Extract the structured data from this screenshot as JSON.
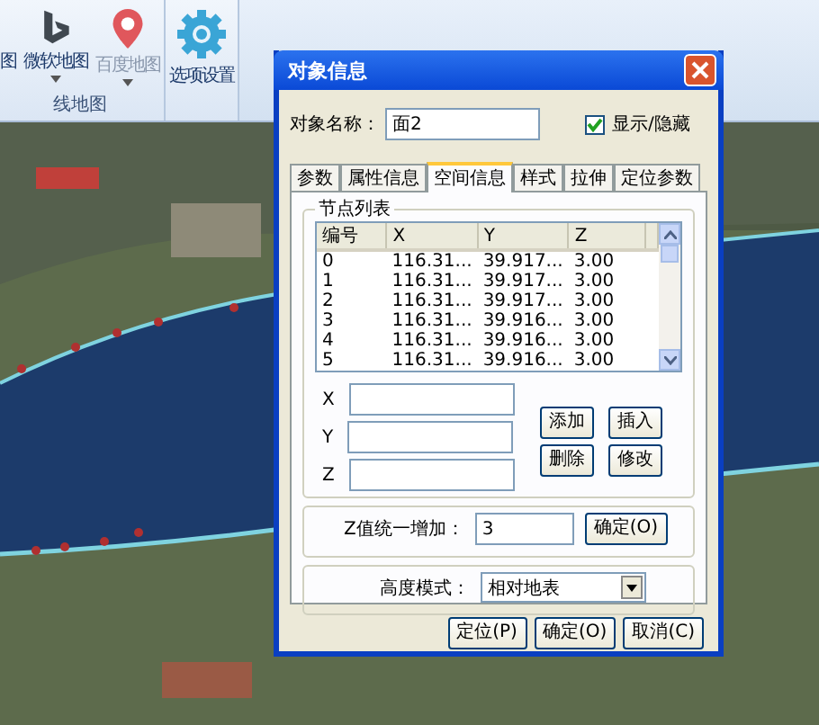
{
  "ribbon": {
    "groups": [
      {
        "label": "线地图",
        "buttons": [
          {
            "label": "图",
            "kind": "partial",
            "disabled": false,
            "dropdown": false
          },
          {
            "label": "微软地图",
            "kind": "bing",
            "disabled": false,
            "dropdown": true
          },
          {
            "label": "百度地图",
            "kind": "pin",
            "disabled": true,
            "dropdown": true
          }
        ]
      },
      {
        "buttons": [
          {
            "label": "选项设置",
            "kind": "gear",
            "disabled": false,
            "dropdown": false
          }
        ]
      }
    ]
  },
  "dialog": {
    "title": "对象信息",
    "name_label": "对象名称：",
    "name_value": "面2",
    "visible": {
      "label": "显示/隐藏",
      "checked": true
    },
    "tabs": [
      {
        "label": "参数",
        "selected": false
      },
      {
        "label": "属性信息",
        "selected": false
      },
      {
        "label": "空间信息",
        "selected": true
      },
      {
        "label": "样式",
        "selected": false
      },
      {
        "label": "拉伸",
        "selected": false
      },
      {
        "label": "定位参数",
        "selected": false
      }
    ],
    "node_list": {
      "title": "节点列表",
      "columns": [
        "编号",
        "X",
        "Y",
        "Z"
      ],
      "rows": [
        [
          "0",
          "116.31...",
          "39.917...",
          "3.00"
        ],
        [
          "1",
          "116.31...",
          "39.917...",
          "3.00"
        ],
        [
          "2",
          "116.31...",
          "39.917...",
          "3.00"
        ],
        [
          "3",
          "116.31...",
          "39.916...",
          "3.00"
        ],
        [
          "4",
          "116.31...",
          "39.916...",
          "3.00"
        ],
        [
          "5",
          "116.31...",
          "39.916...",
          "3.00"
        ]
      ],
      "fields": [
        {
          "label": "X"
        },
        {
          "label": "Y"
        },
        {
          "label": "Z"
        }
      ],
      "buttons": [
        "添加",
        "插入",
        "删除",
        "修改"
      ]
    },
    "z_offset": {
      "label": "Z值统一增加：",
      "value": "3",
      "button": "确定(O)"
    },
    "height_mode": {
      "label": "高度模式：",
      "value": "相对地表"
    },
    "buttons": [
      "定位(P)",
      "确定(O)",
      "取消(C)"
    ]
  }
}
